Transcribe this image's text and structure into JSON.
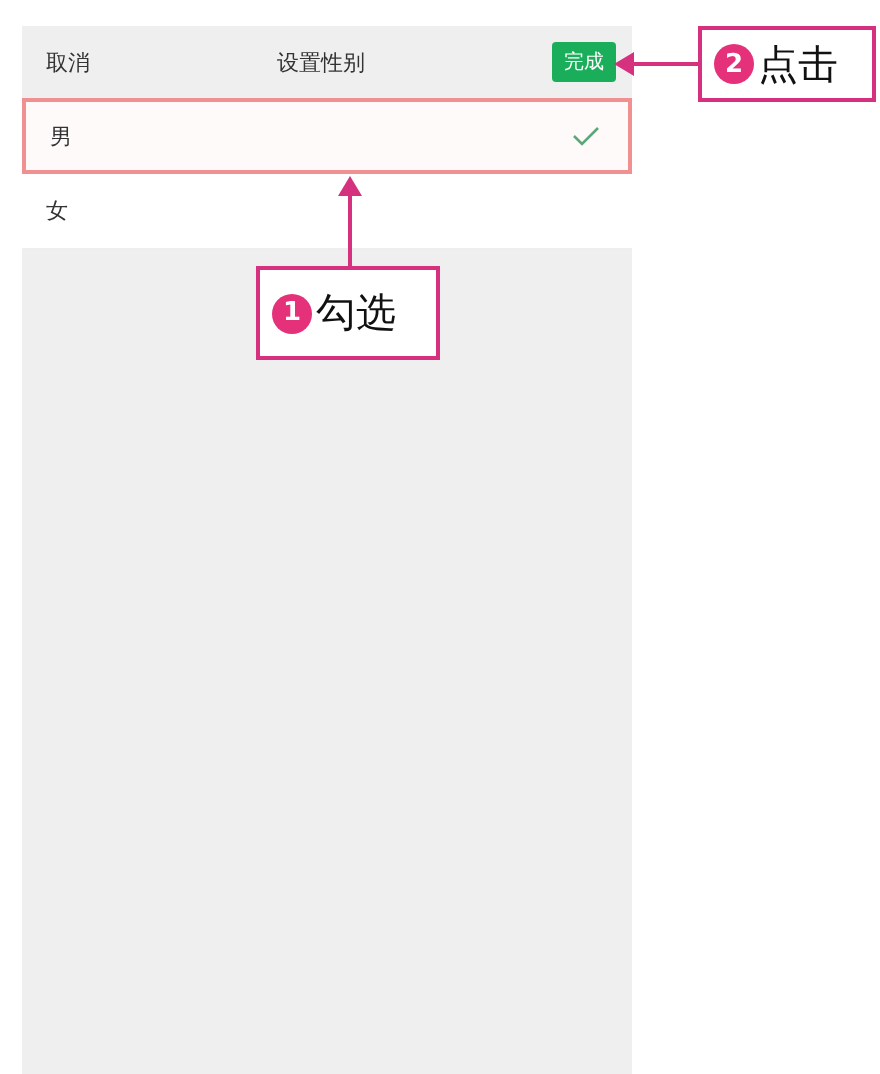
{
  "header": {
    "cancel": "取消",
    "title": "设置性别",
    "done": "完成"
  },
  "options": [
    {
      "label": "男",
      "selected": true
    },
    {
      "label": "女",
      "selected": false
    }
  ],
  "annotations": [
    {
      "number": "1",
      "text": "勾选",
      "kind": "up"
    },
    {
      "number": "2",
      "text": "点击",
      "kind": "left"
    }
  ]
}
